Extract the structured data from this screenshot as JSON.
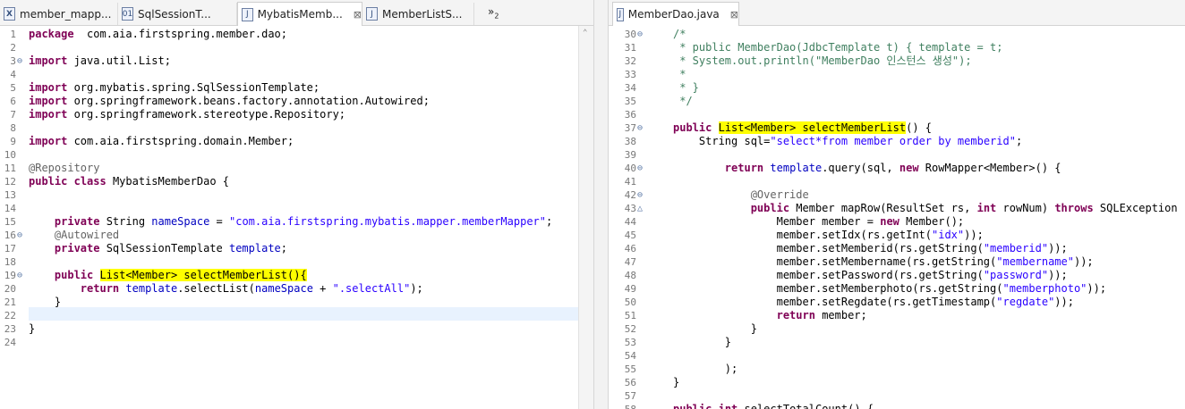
{
  "left_tabs": [
    {
      "label": "member_mapp...",
      "icon": "xml-file-icon",
      "glyph": "X"
    },
    {
      "label": "SqlSessionT...",
      "icon": "class-file-icon",
      "glyph": "01"
    },
    {
      "label": "MybatisMemb...",
      "icon": "java-file-icon",
      "glyph": "J",
      "close": "⊠"
    },
    {
      "label": "MemberListS...",
      "icon": "java-file-icon",
      "glyph": "J"
    }
  ],
  "left_overflow": {
    "symbol": "»",
    "count": "2"
  },
  "right_tabs": [
    {
      "label": "MemberDao.java",
      "icon": "java-file-icon",
      "glyph": "J",
      "close": "⊠"
    }
  ],
  "left_lines": [
    {
      "n": "1",
      "t": [
        [
          "kw",
          "package"
        ],
        [
          "",
          "  com.aia.firstspring.member.dao;"
        ]
      ]
    },
    {
      "n": "2",
      "t": []
    },
    {
      "n": "3",
      "fold": "⊖",
      "t": [
        [
          "kw",
          "import"
        ],
        [
          "",
          " java.util.List;"
        ]
      ]
    },
    {
      "n": "4",
      "t": []
    },
    {
      "n": "5",
      "t": [
        [
          "kw",
          "import"
        ],
        [
          "",
          " org.mybatis.spring.SqlSessionTemplate;"
        ]
      ]
    },
    {
      "n": "6",
      "t": [
        [
          "kw",
          "import"
        ],
        [
          "",
          " org.springframework.beans.factory.annotation.Autowired;"
        ]
      ]
    },
    {
      "n": "7",
      "t": [
        [
          "kw",
          "import"
        ],
        [
          "",
          " org.springframework.stereotype.Repository;"
        ]
      ]
    },
    {
      "n": "8",
      "t": []
    },
    {
      "n": "9",
      "t": [
        [
          "kw",
          "import"
        ],
        [
          "",
          " com.aia.firstspring.domain.Member;"
        ]
      ]
    },
    {
      "n": "10",
      "t": []
    },
    {
      "n": "11",
      "t": [
        [
          "ann",
          "@Repository"
        ]
      ]
    },
    {
      "n": "12",
      "t": [
        [
          "kw",
          "public"
        ],
        [
          "",
          " "
        ],
        [
          "kw",
          "class"
        ],
        [
          "",
          " MybatisMemberDao {"
        ]
      ]
    },
    {
      "n": "13",
      "t": []
    },
    {
      "n": "14",
      "t": []
    },
    {
      "n": "15",
      "t": [
        [
          "",
          "    "
        ],
        [
          "kw",
          "private"
        ],
        [
          "",
          " String "
        ],
        [
          "fld",
          "nameSpace"
        ],
        [
          "",
          " = "
        ],
        [
          "str",
          "\"com.aia.firstspring.mybatis.mapper.memberMapper\""
        ],
        [
          "",
          ";"
        ]
      ]
    },
    {
      "n": "16",
      "fold": "⊖",
      "t": [
        [
          "",
          "    "
        ],
        [
          "ann",
          "@Autowired"
        ]
      ]
    },
    {
      "n": "17",
      "t": [
        [
          "",
          "    "
        ],
        [
          "kw",
          "private"
        ],
        [
          "",
          " SqlSessionTemplate "
        ],
        [
          "fld",
          "template"
        ],
        [
          "",
          ";"
        ]
      ]
    },
    {
      "n": "18",
      "t": []
    },
    {
      "n": "19",
      "fold": "⊖",
      "t": [
        [
          "",
          "    "
        ],
        [
          "kw",
          "public"
        ],
        [
          "",
          " "
        ],
        [
          "hl",
          "List<Member> selectMemberList(){"
        ]
      ]
    },
    {
      "n": "20",
      "t": [
        [
          "",
          "        "
        ],
        [
          "kw",
          "return"
        ],
        [
          "",
          " "
        ],
        [
          "fld",
          "template"
        ],
        [
          ".selectList(",
          ""
        ],
        [
          "fld",
          "nameSpace"
        ],
        [
          "",
          " + "
        ],
        [
          "str",
          "\".selectAll\""
        ],
        [
          "",
          ");"
        ]
      ]
    },
    {
      "n": "21",
      "t": [
        [
          "",
          "    }"
        ]
      ]
    },
    {
      "n": "22",
      "t": []
    },
    {
      "n": "23",
      "t": [
        [
          "",
          "}"
        ]
      ]
    },
    {
      "n": "24",
      "t": []
    }
  ],
  "right_lines": [
    {
      "n": "30",
      "fold": "⊖",
      "t": [
        [
          "cmt",
          "/*"
        ]
      ]
    },
    {
      "n": "31",
      "t": [
        [
          "cmt",
          " * public MemberDao(JdbcTemplate t) { template = t;"
        ]
      ]
    },
    {
      "n": "32",
      "t": [
        [
          "cmt",
          " * System.out.println(\"MemberDao 인스턴스 생성\");"
        ]
      ]
    },
    {
      "n": "33",
      "t": [
        [
          "cmt",
          " *"
        ]
      ]
    },
    {
      "n": "34",
      "t": [
        [
          "cmt",
          " * }"
        ]
      ]
    },
    {
      "n": "35",
      "t": [
        [
          "cmt",
          " */"
        ]
      ]
    },
    {
      "n": "36",
      "t": []
    },
    {
      "n": "37",
      "fold": "⊖",
      "t": [
        [
          "kw",
          "public"
        ],
        [
          "",
          " "
        ],
        [
          "hl",
          "List<Member> selectMemberList"
        ],
        [
          "",
          "() {"
        ]
      ]
    },
    {
      "n": "38",
      "t": [
        [
          "",
          "    String "
        ],
        [
          "",
          "sql"
        ],
        [
          "",
          "="
        ],
        [
          "str",
          "\"select*from member order by memberid\""
        ],
        [
          "",
          ";"
        ]
      ]
    },
    {
      "n": "39",
      "t": []
    },
    {
      "n": "40",
      "fold": "⊖",
      "t": [
        [
          "",
          "        "
        ],
        [
          "kw",
          "return"
        ],
        [
          "",
          " "
        ],
        [
          "fld",
          "template"
        ],
        [
          "",
          ".query(sql, "
        ],
        [
          "kw",
          "new"
        ],
        [
          "",
          " RowMapper<Member>() {"
        ]
      ]
    },
    {
      "n": "41",
      "t": []
    },
    {
      "n": "42",
      "fold": "⊖",
      "t": [
        [
          "",
          "            "
        ],
        [
          "ann",
          "@Override"
        ]
      ]
    },
    {
      "n": "43",
      "fold": "△",
      "t": [
        [
          "",
          "            "
        ],
        [
          "kw",
          "public"
        ],
        [
          "",
          " Member mapRow(ResultSet "
        ],
        [
          "",
          "rs"
        ],
        [
          ", ",
          ""
        ],
        [
          "kw",
          "int"
        ],
        [
          "",
          " "
        ],
        [
          "",
          "rowNum"
        ],
        [
          ") ",
          ""
        ],
        [
          "kw",
          "throws"
        ],
        [
          "",
          " SQLException {"
        ]
      ]
    },
    {
      "n": "44",
      "t": [
        [
          "",
          "                Member "
        ],
        [
          "",
          "member"
        ],
        [
          "",
          " = "
        ],
        [
          "kw",
          "new"
        ],
        [
          "",
          " Member();"
        ]
      ]
    },
    {
      "n": "45",
      "t": [
        [
          "",
          "                "
        ],
        [
          "",
          "member"
        ],
        [
          ".setIdx(",
          ""
        ],
        [
          "",
          "rs"
        ],
        [
          ".getInt(",
          ""
        ],
        [
          "str",
          "\"idx\""
        ],
        [
          "",
          "));"
        ]
      ]
    },
    {
      "n": "46",
      "t": [
        [
          "",
          "                "
        ],
        [
          "",
          "member"
        ],
        [
          ".setMemberid(",
          ""
        ],
        [
          "",
          "rs"
        ],
        [
          ".getString(",
          ""
        ],
        [
          "str",
          "\"memberid\""
        ],
        [
          "",
          "));"
        ]
      ]
    },
    {
      "n": "47",
      "t": [
        [
          "",
          "                "
        ],
        [
          "",
          "member"
        ],
        [
          ".setMembername(",
          ""
        ],
        [
          "",
          "rs"
        ],
        [
          ".getString(",
          ""
        ],
        [
          "str",
          "\"membername\""
        ],
        [
          "",
          "));"
        ]
      ]
    },
    {
      "n": "48",
      "t": [
        [
          "",
          "                "
        ],
        [
          "",
          "member"
        ],
        [
          ".setPassword(",
          ""
        ],
        [
          "",
          "rs"
        ],
        [
          ".getString(",
          ""
        ],
        [
          "str",
          "\"password\""
        ],
        [
          "",
          "));"
        ]
      ]
    },
    {
      "n": "49",
      "t": [
        [
          "",
          "                "
        ],
        [
          "",
          "member"
        ],
        [
          ".setMemberphoto(",
          ""
        ],
        [
          "",
          "rs"
        ],
        [
          ".getString(",
          ""
        ],
        [
          "str",
          "\"memberphoto\""
        ],
        [
          "",
          "));"
        ]
      ]
    },
    {
      "n": "50",
      "t": [
        [
          "",
          "                "
        ],
        [
          "",
          "member"
        ],
        [
          ".setRegdate(",
          ""
        ],
        [
          "",
          "rs"
        ],
        [
          ".getTimestamp(",
          ""
        ],
        [
          "str",
          "\"regdate\""
        ],
        [
          "",
          "));"
        ]
      ]
    },
    {
      "n": "51",
      "t": [
        [
          "",
          "                "
        ],
        [
          "kw",
          "return"
        ],
        [
          "",
          " "
        ],
        [
          "",
          "member"
        ],
        [
          "",
          ";"
        ]
      ]
    },
    {
      "n": "52",
      "t": [
        [
          "",
          "            }"
        ]
      ]
    },
    {
      "n": "53",
      "t": [
        [
          "",
          "        }"
        ]
      ]
    },
    {
      "n": "54",
      "t": []
    },
    {
      "n": "55",
      "t": [
        [
          "",
          "        );"
        ]
      ]
    },
    {
      "n": "56",
      "t": [
        [
          "",
          "}"
        ]
      ]
    },
    {
      "n": "57",
      "t": []
    },
    {
      "n": "58",
      "t": [
        [
          "kw",
          "public"
        ],
        [
          "",
          " "
        ],
        [
          "kw",
          "int"
        ],
        [
          "",
          " selectTotalCount() {"
        ]
      ]
    }
  ]
}
